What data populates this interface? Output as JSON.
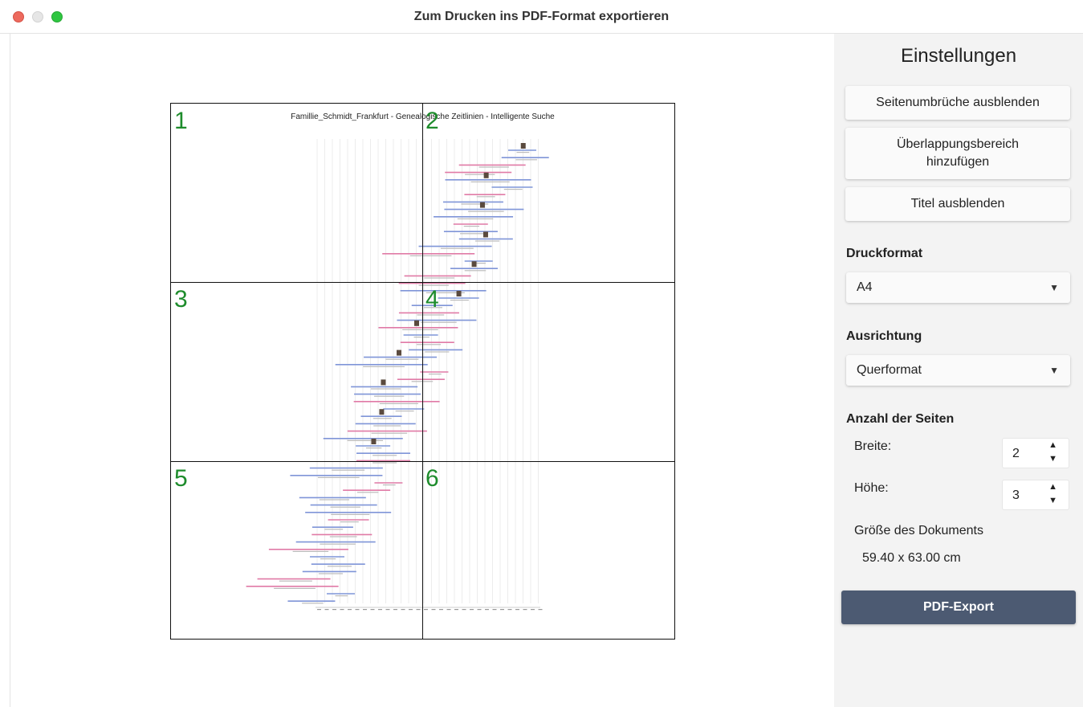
{
  "window": {
    "title": "Zum Drucken ins PDF-Format exportieren"
  },
  "preview": {
    "document_title": "Famillie_Schmidt_Frankfurt - Genealogische Zeitlinien - Intelligente Suche",
    "page_numbers": [
      "1",
      "2",
      "3",
      "4",
      "5",
      "6"
    ],
    "colors": {
      "male_bar": "#7f95d8",
      "female_bar": "#e07aa6",
      "page_number": "#1e8c2c",
      "grid": "#111111"
    }
  },
  "sidebar": {
    "heading": "Einstellungen",
    "buttons": {
      "hide_page_breaks": "Seitenumbrüche ausblenden",
      "add_overlap": "Überlappungsbereich hinzufügen",
      "hide_title": "Titel ausblenden"
    },
    "print_format": {
      "label": "Druckformat",
      "value": "A4"
    },
    "orientation": {
      "label": "Ausrichtung",
      "value": "Querformat"
    },
    "pages": {
      "label": "Anzahl der Seiten",
      "width_label": "Breite:",
      "width_value": "2",
      "height_label": "Höhe:",
      "height_value": "3"
    },
    "doc_size": {
      "label": "Größe des Dokuments",
      "value": "59.40 x 63.00 cm"
    },
    "export_label": "PDF-Export",
    "colors": {
      "export_button": "#4c5a72",
      "panel_bg": "#f3f3f3"
    }
  }
}
